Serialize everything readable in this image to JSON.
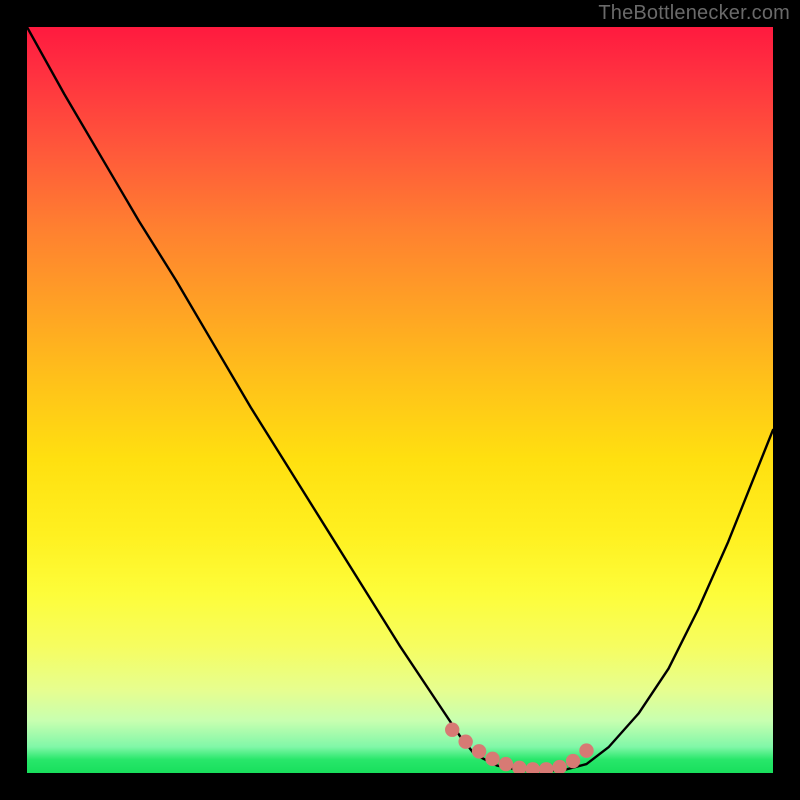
{
  "watermark": "TheBottlenecker.com",
  "colors": {
    "page_bg": "#000000",
    "curve_stroke": "#000000",
    "marker_fill": "#d77a74",
    "watermark": "#6a6a6a"
  },
  "chart_data": {
    "type": "line",
    "title": "",
    "xlabel": "",
    "ylabel": "",
    "xlim": [
      0,
      100
    ],
    "ylim": [
      0,
      100
    ],
    "grid": false,
    "series": [
      {
        "name": "bottleneck-curve",
        "x": [
          0,
          5,
          10,
          15,
          20,
          25,
          30,
          35,
          40,
          45,
          50,
          55,
          58,
          60,
          63,
          66,
          69,
          72,
          75,
          78,
          82,
          86,
          90,
          94,
          98,
          100
        ],
        "y": [
          100,
          91,
          82.5,
          74,
          66,
          57.5,
          49,
          41,
          33,
          25,
          17,
          9.5,
          5,
          2.5,
          1,
          0.4,
          0.3,
          0.4,
          1.2,
          3.5,
          8,
          14,
          22,
          31,
          41,
          46
        ]
      }
    ],
    "markers": {
      "name": "valley-highlight",
      "x": [
        57,
        58.8,
        60.6,
        62.4,
        64.2,
        66,
        67.8,
        69.6,
        71.4,
        73.2,
        75
      ],
      "y": [
        5.8,
        4.2,
        2.9,
        1.9,
        1.2,
        0.7,
        0.5,
        0.5,
        0.8,
        1.6,
        3.0
      ]
    }
  }
}
